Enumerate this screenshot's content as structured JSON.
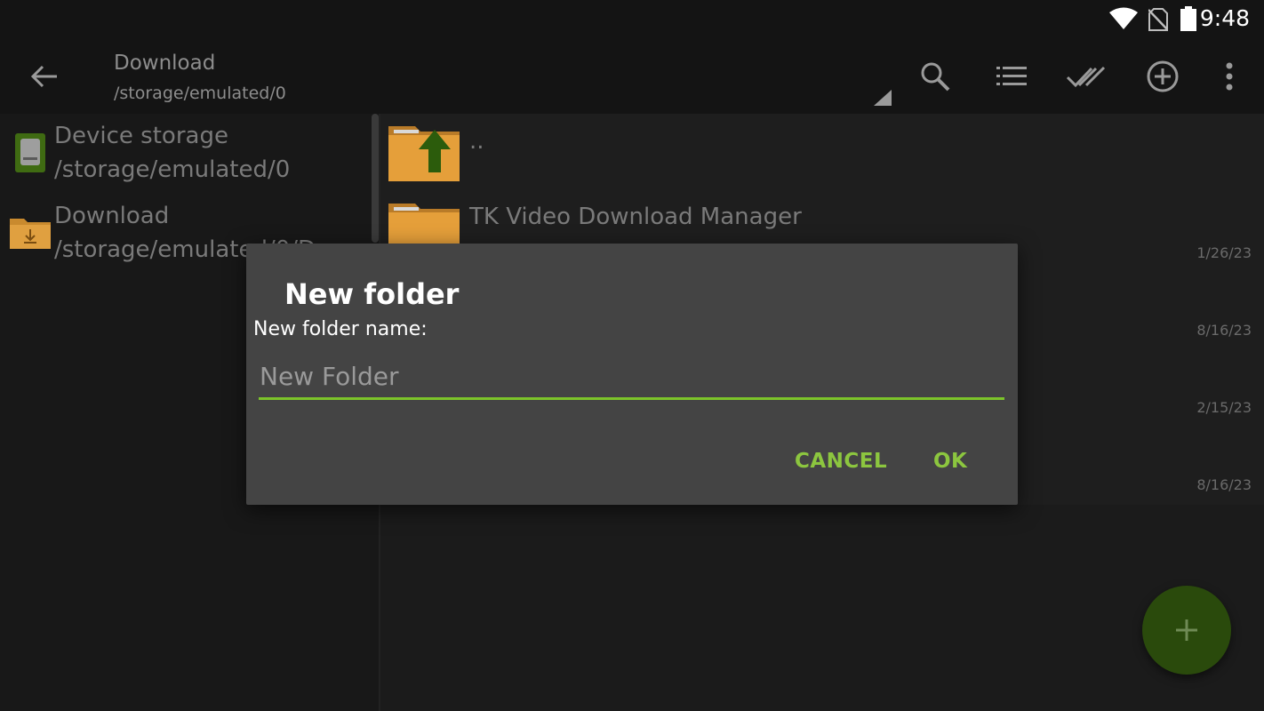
{
  "status_bar": {
    "time": "9:48",
    "icons": [
      "wifi-icon",
      "no-sim-icon",
      "battery-icon"
    ]
  },
  "toolbar": {
    "title": "Download",
    "subtitle": "/storage/emulated/0",
    "icons": [
      "back-arrow-icon",
      "dropdown-triangle-icon",
      "search-icon",
      "list-view-icon",
      "select-all-icon",
      "add-circle-icon",
      "more-vert-icon"
    ]
  },
  "sidebar": {
    "items": [
      {
        "name": "Device storage",
        "path": "/storage/emulated/0",
        "icon": "sd-card-icon"
      },
      {
        "name": "Download",
        "path": "/storage/emulated/0/D",
        "icon": "download-folder-icon"
      }
    ]
  },
  "file_list": {
    "items": [
      {
        "name": "..",
        "date": "",
        "icon": "folder-up-icon"
      },
      {
        "name": "TK Video Download Manager",
        "date": "1/26/23",
        "icon": "folder-icon"
      },
      {
        "name": "",
        "date": "8/16/23"
      },
      {
        "name": "",
        "date": "2/15/23"
      },
      {
        "name": "",
        "date": "8/16/23"
      }
    ]
  },
  "dialog": {
    "title": "New folder",
    "label": "New folder name:",
    "input_value": "",
    "input_placeholder": "New Folder",
    "cancel_label": "CANCEL",
    "ok_label": "OK"
  },
  "fab": {
    "icon": "plus-icon"
  },
  "colors": {
    "accent": "#8cc63f",
    "input_underline": "#7cc42a",
    "dialog_bg": "#444444",
    "fab_bg": "#2a4a0c",
    "folder": "#e59f3a"
  }
}
